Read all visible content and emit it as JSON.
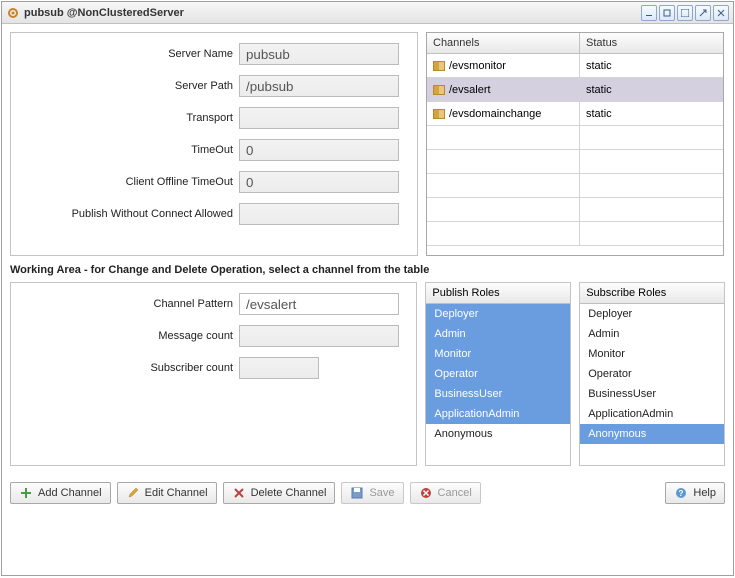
{
  "window": {
    "title": "pubsub @NonClusteredServer"
  },
  "form": {
    "server_name": {
      "label": "Server Name",
      "value": "pubsub"
    },
    "server_path": {
      "label": "Server Path",
      "value": "/pubsub"
    },
    "transport": {
      "label": "Transport",
      "value": ""
    },
    "timeout": {
      "label": "TimeOut",
      "value": "0"
    },
    "client_offline_timeout": {
      "label": "Client Offline TimeOut",
      "value": "0"
    },
    "publish_without_connect": {
      "label": "Publish Without Connect Allowed",
      "value": ""
    }
  },
  "channels": {
    "head_channels": "Channels",
    "head_status": "Status",
    "rows": [
      {
        "name": "/evsmonitor",
        "status": "static",
        "selected": false
      },
      {
        "name": "/evsalert",
        "status": "static",
        "selected": true
      },
      {
        "name": "/evsdomainchange",
        "status": "static",
        "selected": false
      }
    ]
  },
  "working": {
    "heading": "Working Area - for Change and Delete Operation, select a channel from the table",
    "channel_pattern": {
      "label": "Channel Pattern",
      "value": "/evsalert"
    },
    "message_count": {
      "label": "Message count",
      "value": ""
    },
    "subscriber_count": {
      "label": "Subscriber count",
      "value": ""
    }
  },
  "publish_roles": {
    "head": "Publish Roles",
    "items": [
      {
        "label": "Deployer",
        "selected": true
      },
      {
        "label": "Admin",
        "selected": true
      },
      {
        "label": "Monitor",
        "selected": true
      },
      {
        "label": "Operator",
        "selected": true
      },
      {
        "label": "BusinessUser",
        "selected": true
      },
      {
        "label": "ApplicationAdmin",
        "selected": true
      },
      {
        "label": "Anonymous",
        "selected": false
      }
    ]
  },
  "subscribe_roles": {
    "head": "Subscribe Roles",
    "items": [
      {
        "label": "Deployer",
        "selected": false
      },
      {
        "label": "Admin",
        "selected": false
      },
      {
        "label": "Monitor",
        "selected": false
      },
      {
        "label": "Operator",
        "selected": false
      },
      {
        "label": "BusinessUser",
        "selected": false
      },
      {
        "label": "ApplicationAdmin",
        "selected": false
      },
      {
        "label": "Anonymous",
        "selected": true
      }
    ]
  },
  "buttons": {
    "add": "Add Channel",
    "edit": "Edit Channel",
    "delete": "Delete Channel",
    "save": "Save",
    "cancel": "Cancel",
    "help": "Help"
  }
}
